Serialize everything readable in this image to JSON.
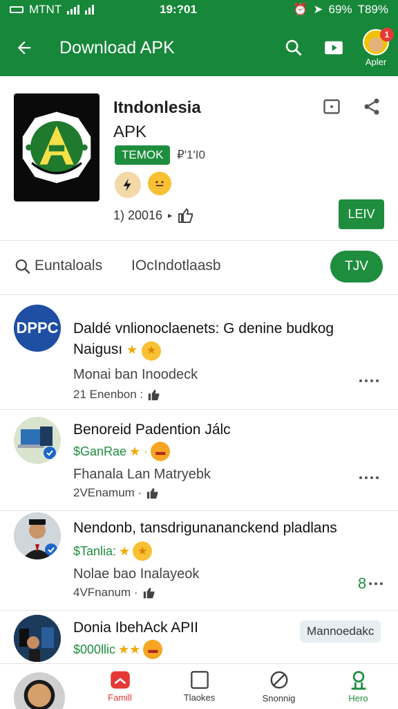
{
  "status_bar": {
    "carrier": "MTNT",
    "time": "19:?01",
    "battery_left": "69%",
    "battery_right": "T89%"
  },
  "app_bar": {
    "title": "Download APK",
    "account_label": "Apler",
    "badge_count": "1"
  },
  "app_card": {
    "name_line1": "Itndonlesia",
    "name_line2": "APK",
    "tag": "TEMOK",
    "tag_meta": "₽'1'I0",
    "downloads": "1) 20016",
    "button": "LEIV"
  },
  "search_row": {
    "label1": "Euntaloals",
    "label2": "IOcIndotlaasb",
    "button": "TJV"
  },
  "list": [
    {
      "thumb_text": "DPPC",
      "title": "Daldé vnlionoclaenets: G denine budkog Naigusı",
      "price": "",
      "subtitle": "Monai ban Inoodeck",
      "meta": "21 Enenbon :"
    },
    {
      "thumb_text": "",
      "title": "Benoreid Padention Jálc",
      "price": "$GanRae",
      "subtitle": "Fhanala Lan Matryebk",
      "meta": "2VEnamum ·"
    },
    {
      "thumb_text": "",
      "title": "Nendonb, tansdrigunananckend pladlans",
      "price": "$Tanlia:",
      "subtitle": "Nolae bao Inalayeok",
      "meta": "4VFnanum ·"
    },
    {
      "thumb_text": "",
      "title": "Donia IbehAck APII",
      "price": "$000llic",
      "chip": "Mannoedakc",
      "subtitle": "",
      "meta": ""
    }
  ],
  "more_prefix": "8",
  "bottom_nav": [
    {
      "label": "Famill"
    },
    {
      "label": "Tlaokes"
    },
    {
      "label": "Snonnig"
    },
    {
      "label": "Hero"
    }
  ],
  "colors": {
    "primary": "#17873a",
    "accent": "#1e8e3e",
    "alert": "#e53935",
    "star": "#f2a900"
  }
}
